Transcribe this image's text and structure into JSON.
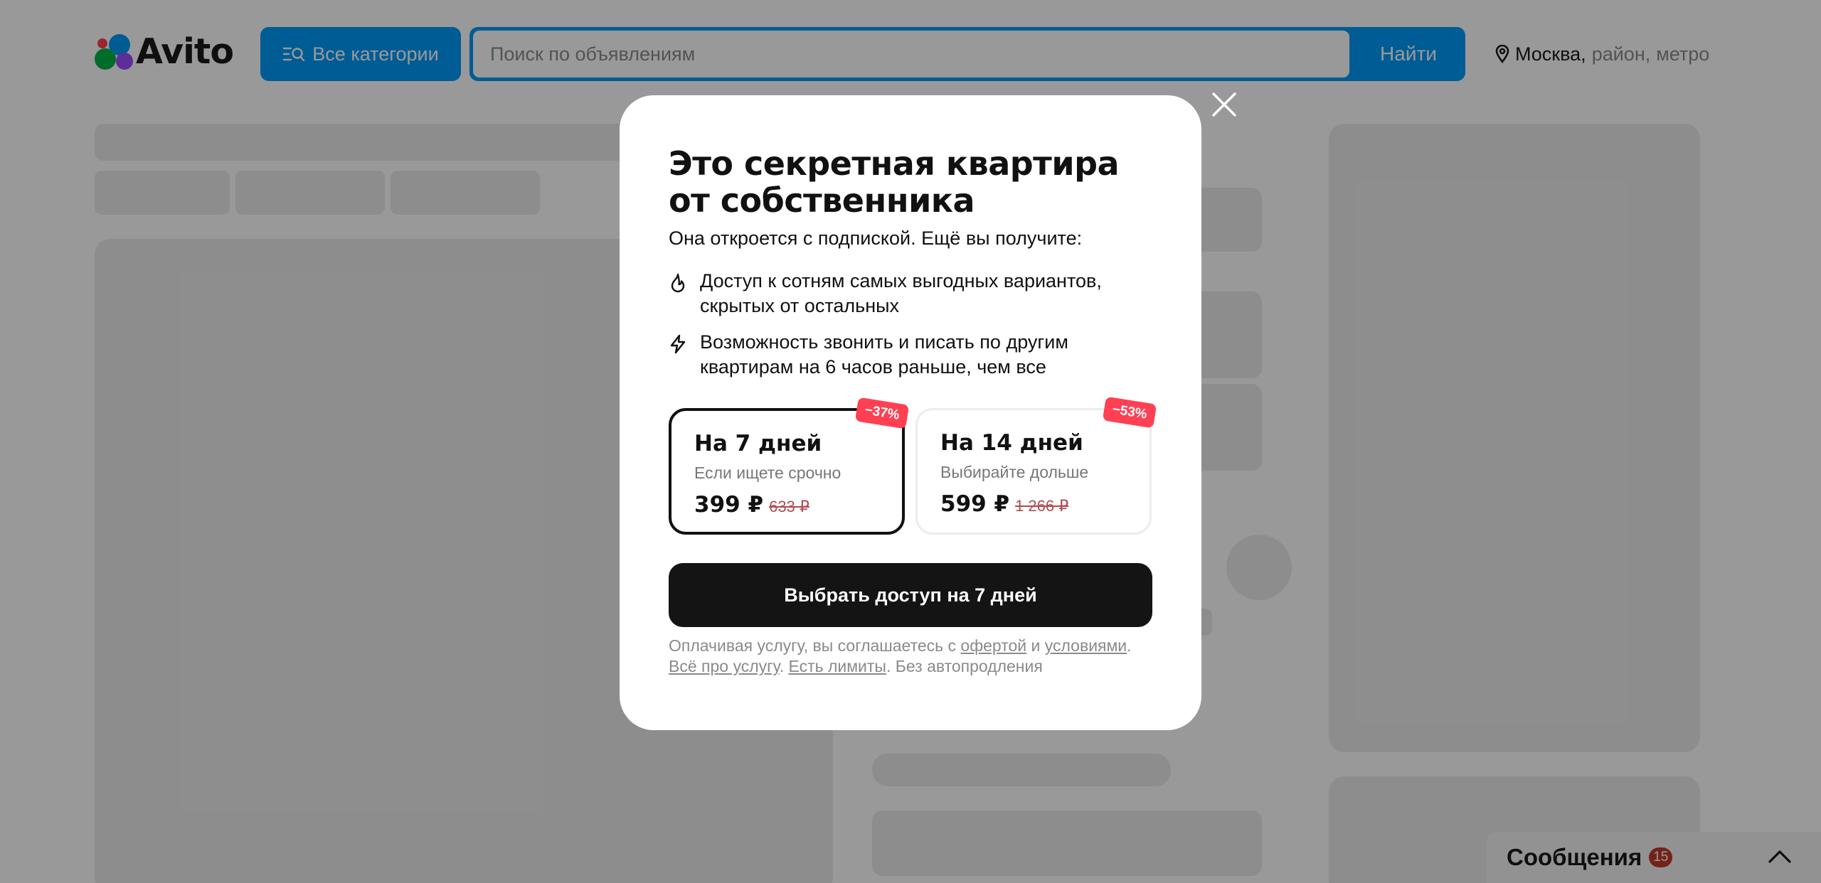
{
  "header": {
    "logo_text": "Avito",
    "categories_label": "Все категории",
    "search_placeholder": "Поиск по объявлениям",
    "search_button": "Найти",
    "location_city": "Москва,",
    "location_district": "район,",
    "location_metro": "метро"
  },
  "modal": {
    "title_line1": "Это секретная квартира",
    "title_line2": "от собственника",
    "subtitle": "Она откроется с подпиской. Ещё вы получите:",
    "features": [
      {
        "icon": "flame-icon",
        "line1": "Доступ к сотням самых выгодных вариантов,",
        "line2": "скрытых от остальных"
      },
      {
        "icon": "lightning-icon",
        "line1": "Возможность звонить и писать по другим",
        "line2": "квартирам на 6 часов раньше, чем все"
      }
    ],
    "plans": [
      {
        "title": "На 7 дней",
        "description": "Если ищете срочно",
        "price": "399 ₽",
        "old_price": "633 ₽",
        "discount": "−37%",
        "selected": true
      },
      {
        "title": "На 14 дней",
        "description": "Выбирайте дольше",
        "price": "599 ₽",
        "old_price": "1 266 ₽",
        "discount": "−53%",
        "selected": false
      }
    ],
    "cta_label": "Выбрать доступ на 7 дней",
    "legal": {
      "part1": "Оплачивая услугу, вы соглашаетесь с",
      "offer_link": "офертой",
      "and": "и",
      "terms_link": "условиями",
      "dot1": ".",
      "about_link": "Всё про услугу",
      "dot2": ".",
      "limits_link": "Есть лимиты",
      "part2": ". Без автопродления"
    }
  },
  "messages": {
    "label": "Сообщения",
    "count": "15"
  },
  "colors": {
    "brand_blue": "#0099f7",
    "discount_red": "#ff4053",
    "cta_black": "#141414",
    "overlay": "rgba(0,0,0,0.40)"
  }
}
